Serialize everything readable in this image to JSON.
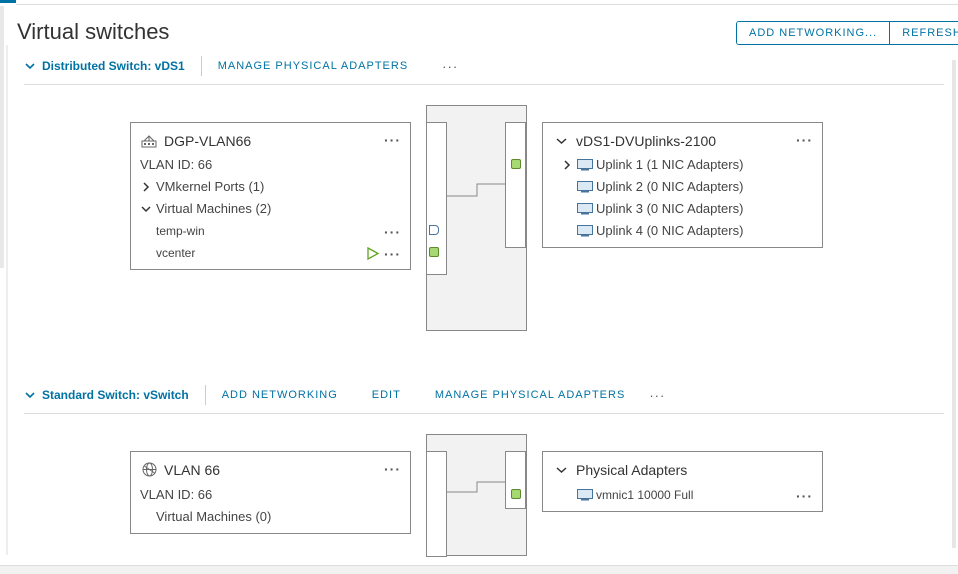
{
  "page": {
    "title": "Virtual switches"
  },
  "toolbar": {
    "add_networking_label": "ADD NETWORKING...",
    "refresh_label": "REFRESH"
  },
  "distributed_switch": {
    "title": "Distributed Switch: vDS1",
    "manage_physical_adapters_label": "MANAGE PHYSICAL ADAPTERS",
    "more_label": "···",
    "port_group": {
      "name": "DGP-VLAN66",
      "vlan_label": "VLAN ID: 66",
      "vmkernel_ports_label": "VMkernel Ports (1)",
      "virtual_machines_label": "Virtual Machines (2)",
      "vms": [
        {
          "name": "temp-win"
        },
        {
          "name": "vcenter"
        }
      ]
    },
    "uplinks": {
      "name": "vDS1-DVUplinks-2100",
      "items": [
        {
          "label": "Uplink 1 (1 NIC Adapters)"
        },
        {
          "label": "Uplink 2 (0 NIC Adapters)"
        },
        {
          "label": "Uplink 3 (0 NIC Adapters)"
        },
        {
          "label": "Uplink 4 (0 NIC Adapters)"
        }
      ]
    }
  },
  "standard_switch": {
    "title": "Standard Switch: vSwitch",
    "add_networking_label": "ADD NETWORKING",
    "edit_label": "EDIT",
    "manage_physical_adapters_label": "MANAGE PHYSICAL ADAPTERS",
    "more_label": "···",
    "port_group": {
      "name": "VLAN 66",
      "vlan_label": "VLAN ID: 66",
      "virtual_machines_label": "Virtual Machines (0)"
    },
    "physical_adapters": {
      "name": "Physical Adapters",
      "items": [
        {
          "label": "vmnic1 10000 Full"
        }
      ]
    }
  },
  "icon_names": [
    "chevron-down-icon",
    "chevron-right-icon",
    "network-icon",
    "globe-icon",
    "nic-icon",
    "play-icon",
    "more-icon"
  ],
  "colors": {
    "accent": "#0072a3",
    "port_green": "#a6d873",
    "border": "#888888"
  }
}
